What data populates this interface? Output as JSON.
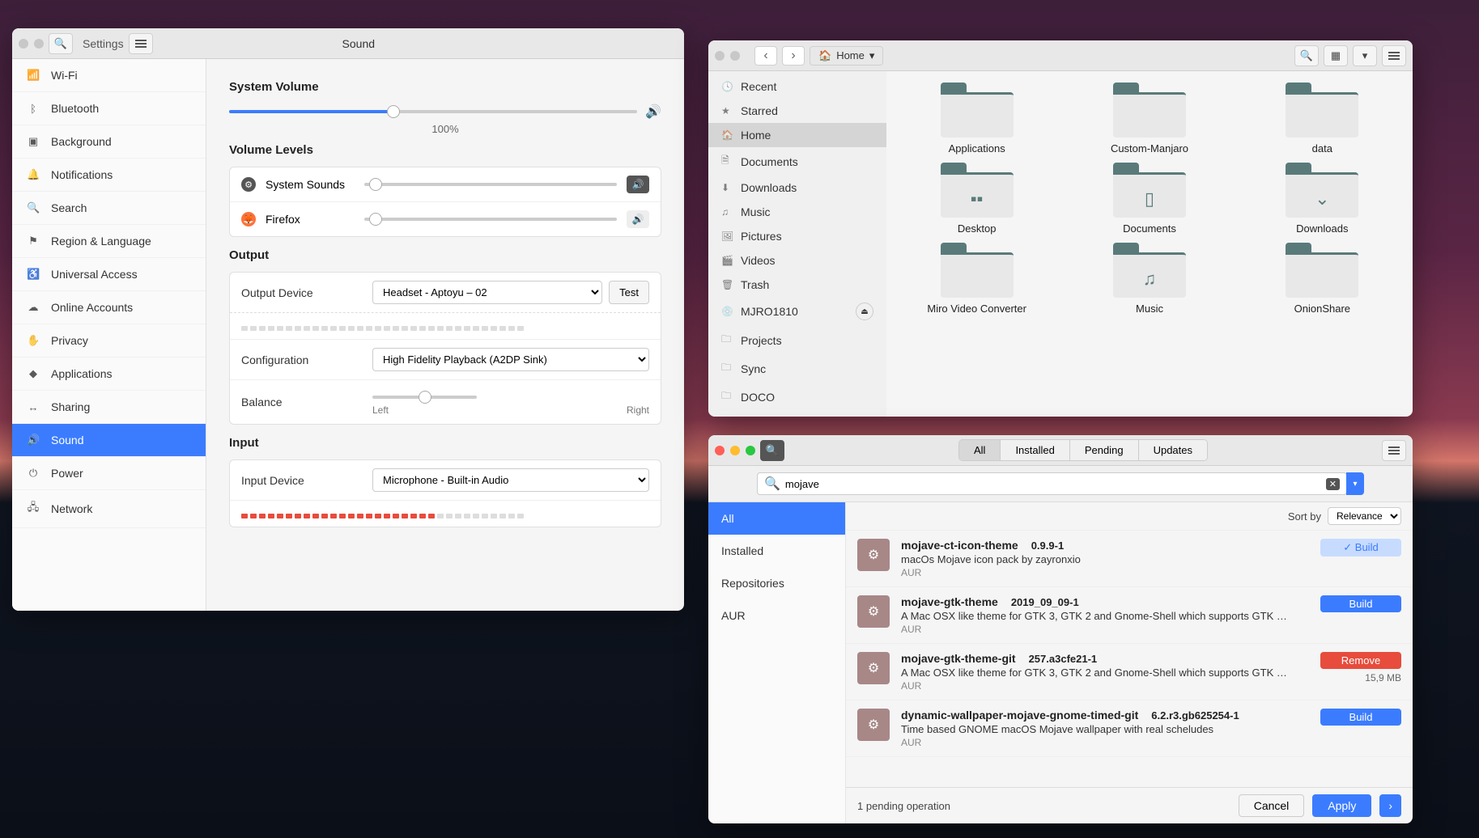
{
  "settings": {
    "breadcrumb": "Settings",
    "title": "Sound",
    "sidebar": [
      {
        "icon": "📶",
        "label": "Wi-Fi"
      },
      {
        "icon": "ᛒ",
        "label": "Bluetooth"
      },
      {
        "icon": "▣",
        "label": "Background"
      },
      {
        "icon": "🔔",
        "label": "Notifications"
      },
      {
        "icon": "🔍",
        "label": "Search"
      },
      {
        "icon": "⚑",
        "label": "Region & Language"
      },
      {
        "icon": "♿",
        "label": "Universal Access"
      },
      {
        "icon": "☁",
        "label": "Online Accounts"
      },
      {
        "icon": "✋",
        "label": "Privacy"
      },
      {
        "icon": "◆",
        "label": "Applications"
      },
      {
        "icon": "↔",
        "label": "Sharing"
      },
      {
        "icon": "🔊",
        "label": "Sound",
        "active": true
      },
      {
        "icon": "⏻",
        "label": "Power"
      },
      {
        "icon": "🖧",
        "label": "Network"
      }
    ],
    "sections": {
      "system_volume": {
        "title": "System Volume",
        "percent": "100%",
        "value": 40
      },
      "volume_levels": {
        "title": "Volume Levels",
        "apps": [
          {
            "name": "System Sounds",
            "icon": "sys",
            "value": 2,
            "muted": true
          },
          {
            "name": "Firefox",
            "icon": "ff",
            "value": 2,
            "muted": false
          }
        ]
      },
      "output": {
        "title": "Output",
        "device_label": "Output Device",
        "device_value": "Headset - Aptoyu  –  02",
        "test": "Test",
        "config_label": "Configuration",
        "config_value": "High Fidelity Playback (A2DP Sink)",
        "balance_label": "Balance",
        "balance_left": "Left",
        "balance_right": "Right"
      },
      "input": {
        "title": "Input",
        "device_label": "Input Device",
        "device_value": "Microphone - Built-in Audio"
      }
    }
  },
  "files": {
    "breadcrumb": "Home",
    "sidebar": [
      {
        "icon": "🕓",
        "label": "Recent"
      },
      {
        "icon": "★",
        "label": "Starred"
      },
      {
        "icon": "🏠",
        "label": "Home",
        "active": true
      },
      {
        "icon": "🗎",
        "label": "Documents"
      },
      {
        "icon": "⬇",
        "label": "Downloads"
      },
      {
        "icon": "♫",
        "label": "Music"
      },
      {
        "icon": "🖼",
        "label": "Pictures"
      },
      {
        "icon": "🎬",
        "label": "Videos"
      },
      {
        "icon": "🗑",
        "label": "Trash"
      },
      {
        "icon": "💿",
        "label": "MJRO1810",
        "eject": true
      },
      {
        "icon": "🗀",
        "label": "Projects"
      },
      {
        "icon": "🗀",
        "label": "Sync"
      },
      {
        "icon": "🗀",
        "label": "DOCO"
      }
    ],
    "folders": [
      {
        "name": "Applications",
        "glyph": ""
      },
      {
        "name": "Custom-Manjaro",
        "glyph": ""
      },
      {
        "name": "data",
        "glyph": ""
      },
      {
        "name": "Desktop",
        "glyph": "▪▪"
      },
      {
        "name": "Documents",
        "glyph": "▯"
      },
      {
        "name": "Downloads",
        "glyph": "⌄"
      },
      {
        "name": "Miro Video Converter",
        "glyph": ""
      },
      {
        "name": "Music",
        "glyph": "♫"
      },
      {
        "name": "OnionShare",
        "glyph": ""
      }
    ]
  },
  "pacman": {
    "tabs": [
      "All",
      "Installed",
      "Pending",
      "Updates"
    ],
    "active_tab": "All",
    "search": "mojave",
    "sidebar": [
      "All",
      "Installed",
      "Repositories",
      "AUR"
    ],
    "sidebar_active": "All",
    "sort_label": "Sort by",
    "sort_value": "Relevance",
    "packages": [
      {
        "name": "mojave-ct-icon-theme",
        "ver": "0.9.9-1",
        "desc": "macOs Mojave icon pack by zayronxio",
        "src": "AUR",
        "action": "Build",
        "action_style": "light",
        "check": true
      },
      {
        "name": "mojave-gtk-theme",
        "ver": "2019_09_09-1",
        "desc": "A Mac OSX like theme for GTK 3, GTK 2 and Gnome-Shell which supports GTK …",
        "src": "AUR",
        "action": "Build",
        "action_style": "blue"
      },
      {
        "name": "mojave-gtk-theme-git",
        "ver": "257.a3cfe21-1",
        "desc": "A Mac OSX like theme for GTK 3, GTK 2 and Gnome-Shell which supports GTK …",
        "src": "AUR",
        "action": "Remove",
        "action_style": "red",
        "size": "15,9 MB"
      },
      {
        "name": "dynamic-wallpaper-mojave-gnome-timed-git",
        "ver": "6.2.r3.gb625254-1",
        "desc": "Time based GNOME macOS Mojave wallpaper with real scheludes",
        "src": "AUR",
        "action": "Build",
        "action_style": "blue"
      }
    ],
    "footer": {
      "status": "1 pending operation",
      "cancel": "Cancel",
      "apply": "Apply"
    }
  }
}
